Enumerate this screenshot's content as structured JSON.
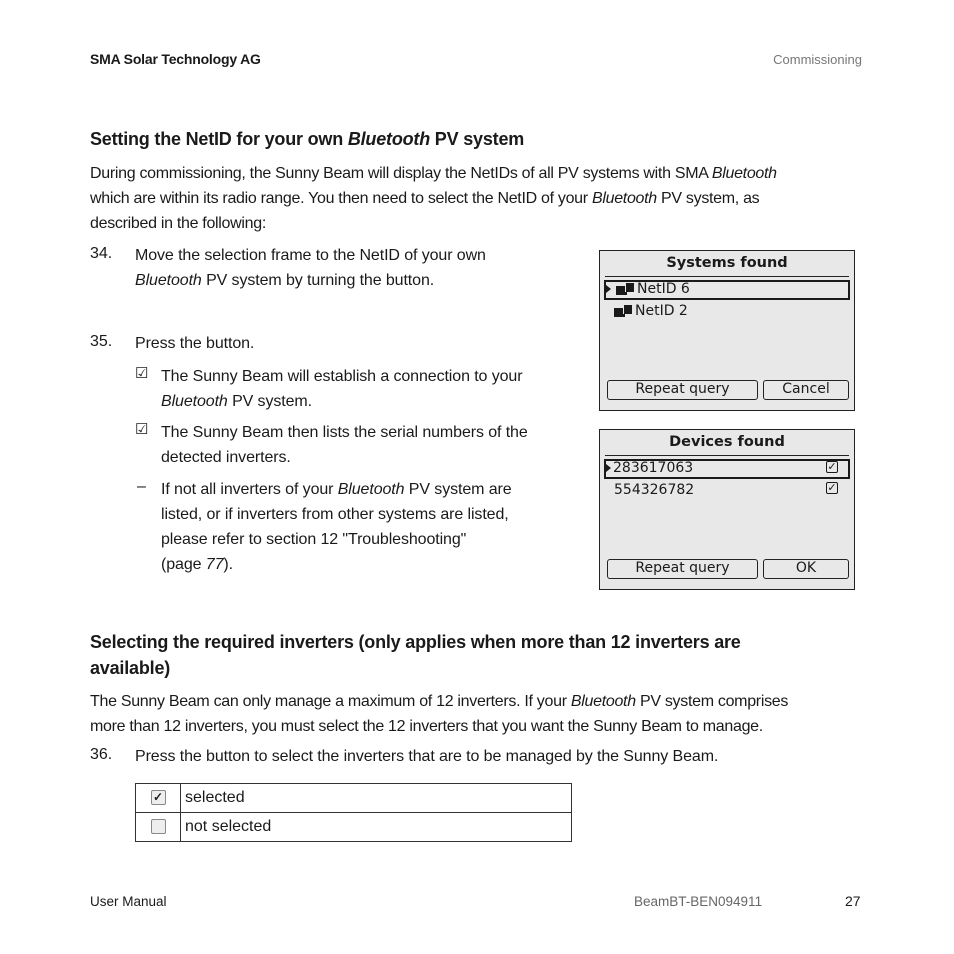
{
  "header": {
    "company": "SMA Solar Technology AG",
    "section": "Commissioning"
  },
  "section1": {
    "title_pre": "Setting the NetID for your own ",
    "title_italic": "Bluetooth",
    "title_post": " PV system",
    "intro": {
      "l1a": "During commissioning, the Sunny Beam will display the NetIDs of all PV systems with SMA ",
      "l1b": "Bluetooth",
      "l2a": "which are within its radio range. You then need to select the NetID of your ",
      "l2b": "Bluetooth",
      "l2c": " PV system, as",
      "l3": "described in the following:"
    },
    "step34": {
      "num": "34.",
      "l1": "Move the selection frame to the NetID of your own",
      "l2a": "Bluetooth",
      "l2b": " PV system by turning the button."
    },
    "step35": {
      "num": "35.",
      "text": "Press the button."
    },
    "result1": {
      "symbol": "☑",
      "l1": "The Sunny Beam will establish a connection to your",
      "l2a": "Bluetooth",
      "l2b": " PV system."
    },
    "result2": {
      "symbol": "☑",
      "l1": "The Sunny Beam then lists the serial numbers of the",
      "l2": "detected inverters."
    },
    "note": {
      "symbol": "–",
      "l1a": "If not all inverters of your ",
      "l1b": "Bluetooth",
      "l1c": " PV system are",
      "l2": "listed, or if inverters from other systems are listed,",
      "l3": "please refer to section 12  \"Troubleshooting\"",
      "l4a": "(page ",
      "l4b": "77",
      "l4c": ")."
    }
  },
  "screen_systems": {
    "title": "Systems found",
    "items": [
      {
        "label": "NetID 6",
        "selected": true,
        "icon": "pv-system-icon"
      },
      {
        "label": "NetID 2",
        "selected": false,
        "icon": "pv-system-icon"
      }
    ],
    "buttons": {
      "left": "Repeat query",
      "right": "Cancel"
    }
  },
  "screen_devices": {
    "title": "Devices found",
    "items": [
      {
        "label": "283617063",
        "selected": true,
        "checked": true
      },
      {
        "label": "554326782",
        "selected": false,
        "checked": true
      }
    ],
    "buttons": {
      "left": "Repeat query",
      "right": "OK"
    }
  },
  "section2": {
    "title_l1": "Selecting the required inverters (only applies when more than 12 inverters are",
    "title_l2": "available)",
    "intro": {
      "l1a": "The Sunny Beam can only manage a maximum of 12 inverters. If your ",
      "l1b": "Bluetooth",
      "l1c": " PV system comprises",
      "l2": "more than 12 inverters, you must select the 12 inverters that you want the Sunny Beam to manage."
    },
    "step36": {
      "num": "36.",
      "text": "Press the button to select the inverters that are to be managed by the Sunny Beam."
    },
    "legend": [
      {
        "symbol": "✓",
        "label": "selected"
      },
      {
        "symbol": "",
        "label": "not selected"
      }
    ]
  },
  "footer": {
    "left": "User Manual",
    "doc_id": "BeamBT-BEN094911",
    "page": "27"
  }
}
